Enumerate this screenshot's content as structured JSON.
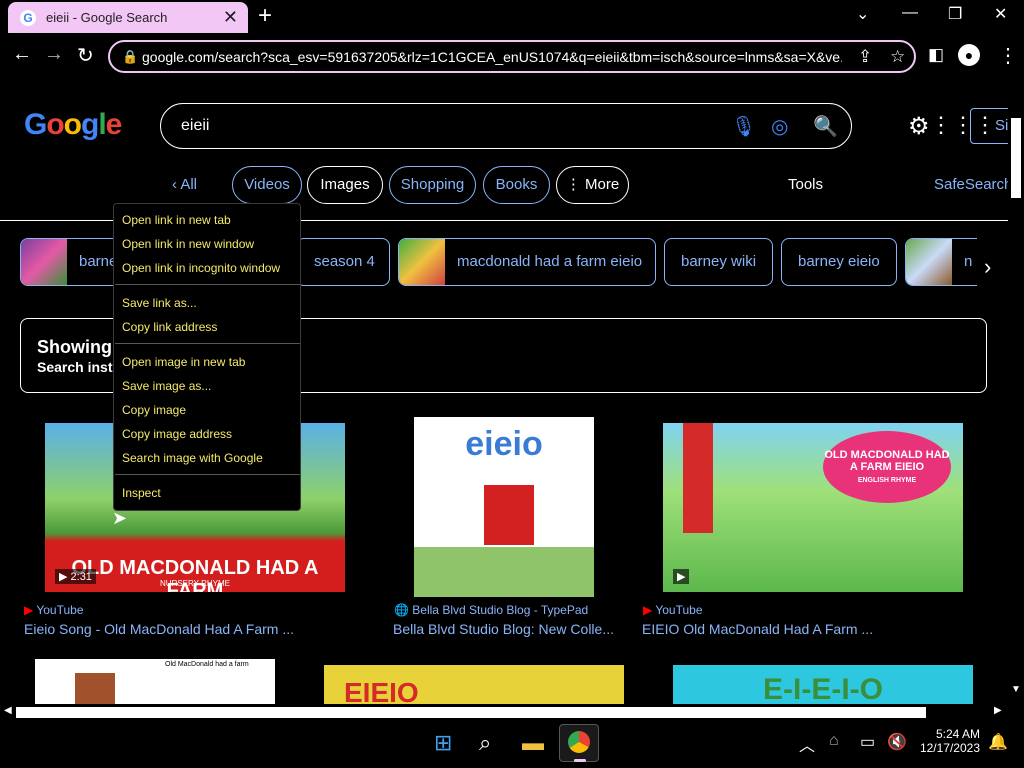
{
  "browser": {
    "tab_title": "eieii - Google Search",
    "tab_favicon": "G",
    "url": "google.com/search?sca_esv=591637205&rlz=1C1GCEA_enUS1074&q=eieii&tbm=isch&source=lnms&sa=X&ve..."
  },
  "google": {
    "logo": "Google",
    "query": "eieii",
    "signin": "Si"
  },
  "filters": {
    "all": "All",
    "chips": [
      "Videos",
      "Images",
      "Shopping",
      "Books",
      "⋮ More"
    ],
    "tools": "Tools",
    "safesearch": "SafeSearch"
  },
  "related": [
    {
      "label": "barney"
    },
    {
      "label": "season 4"
    },
    {
      "label": "macdonald had a farm eieio"
    },
    {
      "label": "barney wiki"
    },
    {
      "label": "barney eieio"
    },
    {
      "label": "n"
    }
  ],
  "notice": {
    "line1": "Showing r",
    "line2": "Search inste"
  },
  "results": [
    {
      "source": "YouTube",
      "title": "Eieio Song - Old MacDonald Had A Farm ...",
      "duration": "2:31",
      "caption": "OLD MACDONALD HAD A FARM",
      "subcaption": "NURSERY RHYME"
    },
    {
      "source": "Bella Blvd Studio Blog - TypePad",
      "title": "Bella Blvd Studio Blog: New Colle...",
      "caption": "eieio"
    },
    {
      "source": "YouTube",
      "title": "EIEIO Old MacDonald Had A Farm ...",
      "caption": "OLD MACDONALD HAD A FARM EIEIO",
      "subcaption": "ENGLISH RHYME"
    }
  ],
  "row2": [
    {
      "caption": "Old MacDonald had a farm"
    },
    {
      "caption": "EIEIO"
    },
    {
      "caption": "E-I-E-I-O"
    }
  ],
  "context_menu": {
    "group1": [
      "Open link in new tab",
      "Open link in new window",
      "Open link in incognito window"
    ],
    "group2": [
      "Save link as...",
      "Copy link address"
    ],
    "group3": [
      "Open image in new tab",
      "Save image as...",
      "Copy image",
      "Copy image address",
      "Search image with Google"
    ],
    "group4": [
      "Inspect"
    ]
  },
  "taskbar": {
    "time": "5:24 AM",
    "date": "12/17/2023"
  }
}
